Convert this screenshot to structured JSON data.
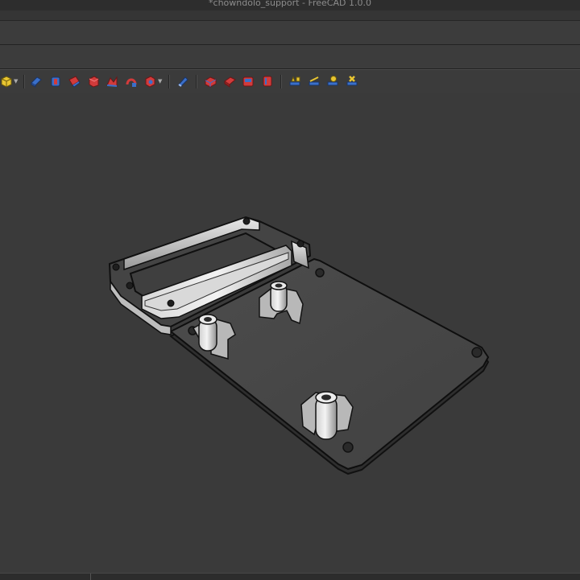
{
  "window": {
    "title": "*chowndolo_support - FreeCAD 1.0.0"
  },
  "toolbar": {
    "buttons": [
      {
        "name": "part-box-icon",
        "color": "#e8c531"
      },
      {
        "name": "extrude-icon",
        "color": "#3a6fc9"
      },
      {
        "name": "revolve-icon",
        "color": "#3a6fc9"
      },
      {
        "name": "mirror-icon",
        "color": "#d23b3b"
      },
      {
        "name": "fillet-icon",
        "color": "#d23b3b"
      },
      {
        "name": "chamfer-icon",
        "color": "#d23b3b"
      },
      {
        "name": "loft-icon",
        "color": "#d23b3b"
      },
      {
        "name": "sweep-icon",
        "color": "#d23b3b"
      },
      {
        "name": "offset-icon",
        "color": "#d23b3b"
      },
      {
        "name": "thickness-icon",
        "color": "#3a6fc9"
      },
      {
        "name": "boolean-icon",
        "color": "#d23b3b"
      },
      {
        "name": "cut-icon",
        "color": "#d23b3b"
      },
      {
        "name": "fuse-icon",
        "color": "#d23b3b"
      },
      {
        "name": "common-icon",
        "color": "#d23b3b"
      },
      {
        "name": "measure-linear-icon",
        "color": "#e8c531"
      },
      {
        "name": "measure-angular-icon",
        "color": "#e8c531"
      },
      {
        "name": "measure-refresh-icon",
        "color": "#e8c531"
      },
      {
        "name": "measure-clear-icon",
        "color": "#e8c531"
      }
    ]
  },
  "viewport": {
    "model": "3d-part-base-plate",
    "background": "#3a3a3a"
  }
}
